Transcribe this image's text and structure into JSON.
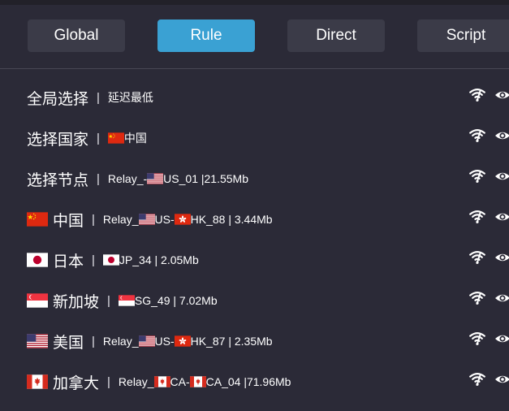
{
  "modes": [
    {
      "label": "Global",
      "active": false
    },
    {
      "label": "Rule",
      "active": true
    },
    {
      "label": "Direct",
      "active": false
    },
    {
      "label": "Script",
      "active": false
    }
  ],
  "groups": [
    {
      "name": "全局选择",
      "flag": "",
      "value": [
        {
          "t": "延迟最低"
        }
      ]
    },
    {
      "name": "选择国家",
      "flag": "",
      "value": [
        {
          "f": "cn"
        },
        {
          "t": "中国"
        }
      ]
    },
    {
      "name": "选择节点",
      "flag": "",
      "value": [
        {
          "t": "Relay_-"
        },
        {
          "f": "us"
        },
        {
          "t": "US_01 |21.55Mb"
        }
      ]
    },
    {
      "name": "中国",
      "flag": "cn",
      "value": [
        {
          "t": "Relay_"
        },
        {
          "f": "us"
        },
        {
          "t": "US-"
        },
        {
          "f": "hk"
        },
        {
          "t": "HK_88 | 3.44Mb"
        }
      ]
    },
    {
      "name": "日本",
      "flag": "jp",
      "value": [
        {
          "f": "jp"
        },
        {
          "t": "JP_34 | 2.05Mb"
        }
      ]
    },
    {
      "name": "新加坡",
      "flag": "sg",
      "value": [
        {
          "f": "sg"
        },
        {
          "t": "SG_49 | 7.02Mb"
        }
      ]
    },
    {
      "name": "美国",
      "flag": "us",
      "value": [
        {
          "t": "Relay_"
        },
        {
          "f": "us"
        },
        {
          "t": "US-"
        },
        {
          "f": "hk"
        },
        {
          "t": "HK_87 | 2.35Mb"
        }
      ]
    },
    {
      "name": "加拿大",
      "flag": "ca",
      "value": [
        {
          "t": "Relay_"
        },
        {
          "f": "ca"
        },
        {
          "t": "CA-"
        },
        {
          "f": "ca"
        },
        {
          "t": "CA_04 |71.96Mb"
        }
      ]
    }
  ],
  "separator": "|",
  "icons": {
    "latency": "wifi-icon",
    "view": "eye-icon"
  },
  "colors": {
    "background": "#2b2a37",
    "button": "#3b3b48",
    "active": "#3aa1d3"
  }
}
